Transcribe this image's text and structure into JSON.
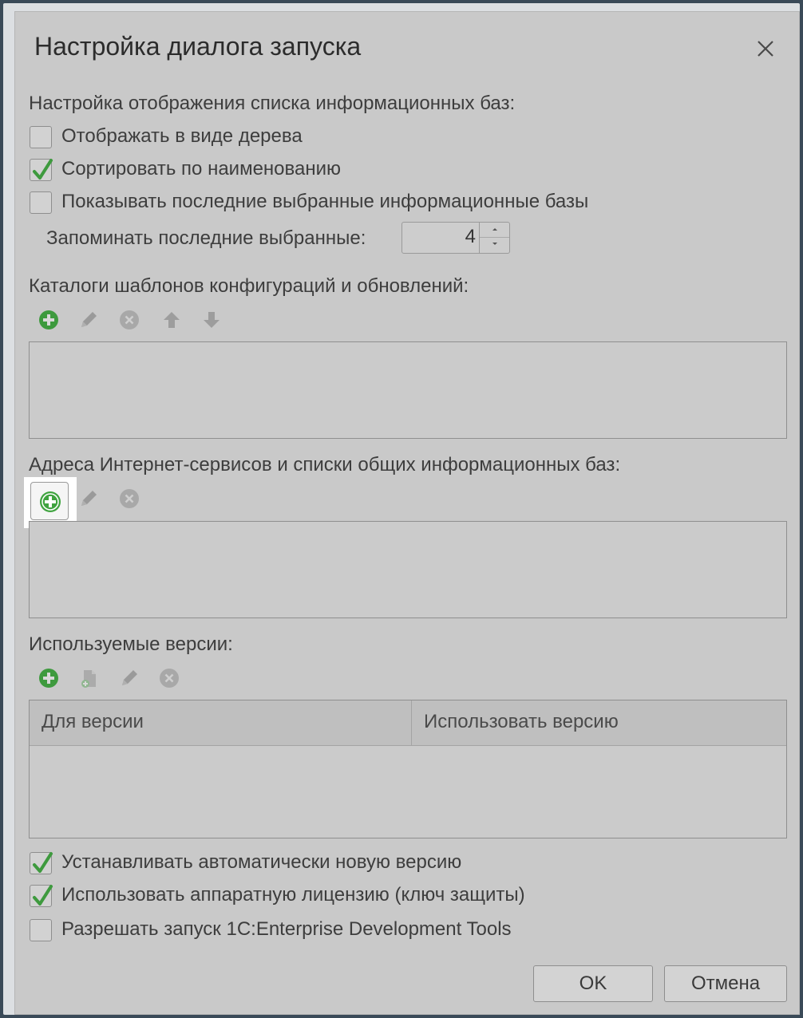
{
  "dialog": {
    "title": "Настройка диалога запуска",
    "close_icon": "close-icon"
  },
  "list_display": {
    "heading": "Настройка отображения списка информационных баз:",
    "options": [
      {
        "label": "Отображать в виде дерева",
        "checked": false
      },
      {
        "label": "Сортировать по наименованию",
        "checked": true
      },
      {
        "label": "Показывать последние выбранные информационные базы",
        "checked": false
      }
    ],
    "remember_label": "Запоминать последние выбранные:",
    "remember_value": "4"
  },
  "templates": {
    "heading": "Каталоги шаблонов конфигураций и обновлений:",
    "toolbar": [
      "add-icon",
      "edit-icon",
      "delete-icon",
      "move-up-icon",
      "move-down-icon"
    ]
  },
  "internet": {
    "heading": "Адреса Интернет-сервисов и списки общих информационных баз:",
    "toolbar": [
      "add-icon",
      "edit-icon",
      "delete-icon"
    ]
  },
  "versions": {
    "heading": "Используемые версии:",
    "toolbar": [
      "add-icon",
      "copy-icon",
      "edit-icon",
      "delete-icon"
    ],
    "columns": [
      "Для версии",
      "Использовать версию"
    ]
  },
  "bottom_options": [
    {
      "label": "Устанавливать автоматически новую версию",
      "checked": true
    },
    {
      "label": "Использовать аппаратную лицензию (ключ защиты)",
      "checked": true
    },
    {
      "label": "Разрешать запуск 1C:Enterprise Development Tools",
      "checked": false
    }
  ],
  "buttons": {
    "ok": "OK",
    "cancel": "Отмена"
  },
  "colors": {
    "accent_green": "#3e9a3e",
    "dim_gray": "#9a9a9a",
    "highlight": "#ffffff"
  }
}
